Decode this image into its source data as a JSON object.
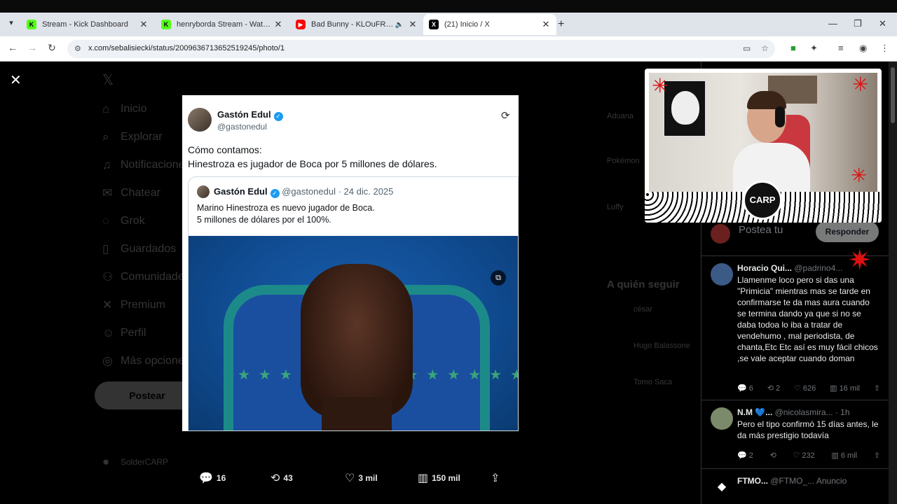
{
  "browser": {
    "tabs": [
      {
        "title": "Stream - Kick Dashboard",
        "favicon": "kick-icon"
      },
      {
        "title": "henryborda Stream - Watch Live",
        "favicon": "kick-icon"
      },
      {
        "title": "Bad Bunny - KLOuFRENS (V",
        "favicon": "youtube-icon"
      },
      {
        "title": "(21) Inicio / X",
        "favicon": "x-icon"
      }
    ],
    "active_tab": 3,
    "url": "x.com/sebalisiecki/status/2009636713652519245/photo/1"
  },
  "sidebar": {
    "items": [
      {
        "label": "Inicio",
        "icon": "home-icon"
      },
      {
        "label": "Explorar",
        "icon": "search-icon"
      },
      {
        "label": "Notificaciones",
        "icon": "bell-icon"
      },
      {
        "label": "Chatear",
        "icon": "mail-icon"
      },
      {
        "label": "Grok",
        "icon": "grok-icon"
      },
      {
        "label": "Guardados",
        "icon": "bookmark-icon"
      },
      {
        "label": "Comunidades",
        "icon": "people-icon"
      },
      {
        "label": "Premium",
        "icon": "x-icon"
      },
      {
        "label": "Perfil",
        "icon": "person-icon"
      },
      {
        "label": "Más opciones",
        "icon": "more-icon"
      }
    ],
    "post_button": "Postear",
    "account_name": "SolderCARP"
  },
  "tweet": {
    "author": "Gastón Edul",
    "handle": "@gastonedul",
    "text_line1": "Cómo contamos:",
    "text_line2": "Hinestroza es jugador de Boca por 5 millones de dólares.",
    "quote": {
      "author": "Gastón Edul",
      "handle_date": "@gastonedul · 24 dic. 2025",
      "line1": "Marino Hinestroza es nuevo jugador de Boca.",
      "line2": "5 millones de dólares por el 100%."
    }
  },
  "media_actions": {
    "replies": "16",
    "reposts": "43",
    "likes": "3 mil",
    "views": "150 mil"
  },
  "right_column": {
    "section": "A quién seguir",
    "trends": [
      "Aduana",
      "Pokémon",
      "Luffy"
    ],
    "people": [
      "césar",
      "Hugo Balassone",
      "Tomo Saca"
    ]
  },
  "reply_box": {
    "placeholder": "Postea tu",
    "button": "Responder"
  },
  "replies": [
    {
      "name": "Horacio Qui...",
      "handle": "@padrino4...",
      "text": "Llamenme loco pero si das una \"Primicia\" mientras mas se tarde en confirmarse te da mas aura cuando se termina dando ya que si no se daba todoa lo iba a tratar de vendehumo , mal periodista, de chanta,Etc Etc así es muy fácil chicos ,se vale aceptar cuando doman",
      "comments": "6",
      "reposts": "2",
      "likes": "626",
      "views": "16 mil"
    },
    {
      "name": "N.M 💙...",
      "handle": "@nicolasmira...",
      "time": "· 1h",
      "text": "Pero el tipo confirmó 15 días antes, le da más prestigio todavía",
      "comments": "2",
      "reposts": "",
      "likes": "232",
      "views": "6 mil"
    },
    {
      "name": "FTMO...",
      "handle": "@FTMO_...",
      "time": "Anuncio",
      "text": ""
    }
  ],
  "webcam": {
    "logo_text": "CARP"
  },
  "colors": {
    "x_blue": "#1d9bf0",
    "kick_green": "#53fc18",
    "youtube_red": "#ff0000"
  }
}
